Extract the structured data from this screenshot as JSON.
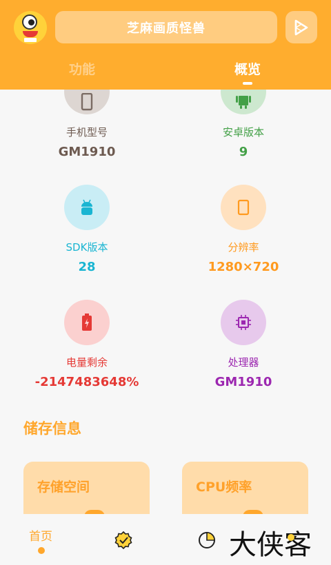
{
  "header": {
    "title": "芝麻画质怪兽",
    "tabs": [
      {
        "label": "功能",
        "active": false
      },
      {
        "label": "概览",
        "active": true
      }
    ],
    "color": "#ffad2e"
  },
  "overview": {
    "items": [
      {
        "label": "手机型号",
        "value": "GM1910",
        "icon": "phone-icon",
        "label_color": "#6d5a50",
        "value_color": "#6d5a50"
      },
      {
        "label": "安卓版本",
        "value": "9",
        "icon": "android-icon",
        "label_color": "#43a047",
        "value_color": "#43a047"
      },
      {
        "label": "SDK版本",
        "value": "28",
        "icon": "android-robot-icon",
        "label_color": "#1ab5d2",
        "value_color": "#1ab5d2"
      },
      {
        "label": "分辨率",
        "value": "1280×720",
        "icon": "screen-icon",
        "label_color": "#ff9a1f",
        "value_color": "#ff9a1f"
      },
      {
        "label": "电量剩余",
        "value": "-2147483648%",
        "icon": "battery-icon",
        "label_color": "#e53935",
        "value_color": "#e53935"
      },
      {
        "label": "处理器",
        "value": "GM1910",
        "icon": "chip-icon",
        "label_color": "#9c27b0",
        "value_color": "#9c27b0"
      }
    ]
  },
  "storage": {
    "section_title": "储存信息",
    "cards": [
      {
        "title": "存储空间"
      },
      {
        "title": "CPU频率"
      }
    ]
  },
  "bottom_nav": {
    "home_label": "首页"
  },
  "watermark": "大侠客"
}
